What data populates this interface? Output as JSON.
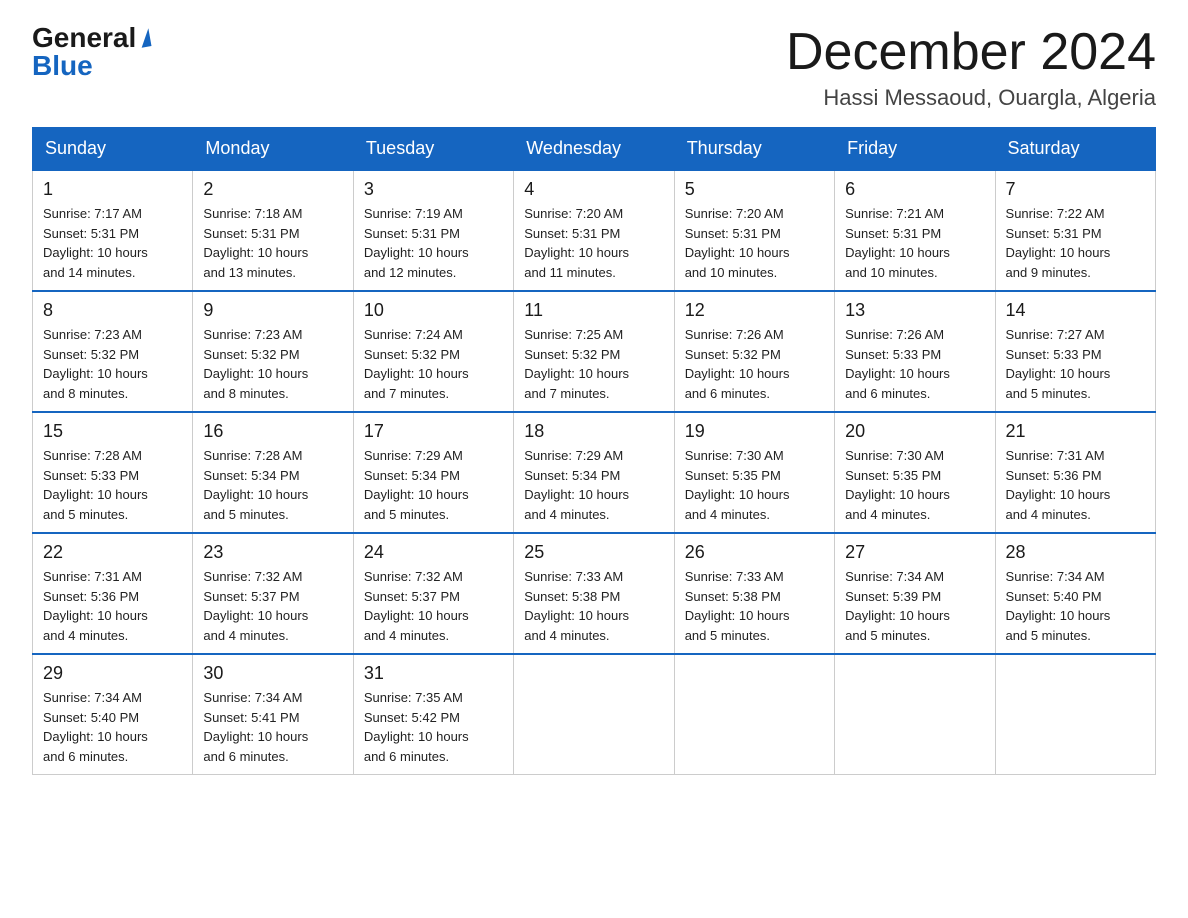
{
  "logo": {
    "general": "General",
    "blue": "Blue"
  },
  "header": {
    "title": "December 2024",
    "location": "Hassi Messaoud, Ouargla, Algeria"
  },
  "weekdays": [
    "Sunday",
    "Monday",
    "Tuesday",
    "Wednesday",
    "Thursday",
    "Friday",
    "Saturday"
  ],
  "weeks": [
    [
      {
        "day": "1",
        "sunrise": "7:17 AM",
        "sunset": "5:31 PM",
        "daylight": "10 hours and 14 minutes."
      },
      {
        "day": "2",
        "sunrise": "7:18 AM",
        "sunset": "5:31 PM",
        "daylight": "10 hours and 13 minutes."
      },
      {
        "day": "3",
        "sunrise": "7:19 AM",
        "sunset": "5:31 PM",
        "daylight": "10 hours and 12 minutes."
      },
      {
        "day": "4",
        "sunrise": "7:20 AM",
        "sunset": "5:31 PM",
        "daylight": "10 hours and 11 minutes."
      },
      {
        "day": "5",
        "sunrise": "7:20 AM",
        "sunset": "5:31 PM",
        "daylight": "10 hours and 10 minutes."
      },
      {
        "day": "6",
        "sunrise": "7:21 AM",
        "sunset": "5:31 PM",
        "daylight": "10 hours and 10 minutes."
      },
      {
        "day": "7",
        "sunrise": "7:22 AM",
        "sunset": "5:31 PM",
        "daylight": "10 hours and 9 minutes."
      }
    ],
    [
      {
        "day": "8",
        "sunrise": "7:23 AM",
        "sunset": "5:32 PM",
        "daylight": "10 hours and 8 minutes."
      },
      {
        "day": "9",
        "sunrise": "7:23 AM",
        "sunset": "5:32 PM",
        "daylight": "10 hours and 8 minutes."
      },
      {
        "day": "10",
        "sunrise": "7:24 AM",
        "sunset": "5:32 PM",
        "daylight": "10 hours and 7 minutes."
      },
      {
        "day": "11",
        "sunrise": "7:25 AM",
        "sunset": "5:32 PM",
        "daylight": "10 hours and 7 minutes."
      },
      {
        "day": "12",
        "sunrise": "7:26 AM",
        "sunset": "5:32 PM",
        "daylight": "10 hours and 6 minutes."
      },
      {
        "day": "13",
        "sunrise": "7:26 AM",
        "sunset": "5:33 PM",
        "daylight": "10 hours and 6 minutes."
      },
      {
        "day": "14",
        "sunrise": "7:27 AM",
        "sunset": "5:33 PM",
        "daylight": "10 hours and 5 minutes."
      }
    ],
    [
      {
        "day": "15",
        "sunrise": "7:28 AM",
        "sunset": "5:33 PM",
        "daylight": "10 hours and 5 minutes."
      },
      {
        "day": "16",
        "sunrise": "7:28 AM",
        "sunset": "5:34 PM",
        "daylight": "10 hours and 5 minutes."
      },
      {
        "day": "17",
        "sunrise": "7:29 AM",
        "sunset": "5:34 PM",
        "daylight": "10 hours and 5 minutes."
      },
      {
        "day": "18",
        "sunrise": "7:29 AM",
        "sunset": "5:34 PM",
        "daylight": "10 hours and 4 minutes."
      },
      {
        "day": "19",
        "sunrise": "7:30 AM",
        "sunset": "5:35 PM",
        "daylight": "10 hours and 4 minutes."
      },
      {
        "day": "20",
        "sunrise": "7:30 AM",
        "sunset": "5:35 PM",
        "daylight": "10 hours and 4 minutes."
      },
      {
        "day": "21",
        "sunrise": "7:31 AM",
        "sunset": "5:36 PM",
        "daylight": "10 hours and 4 minutes."
      }
    ],
    [
      {
        "day": "22",
        "sunrise": "7:31 AM",
        "sunset": "5:36 PM",
        "daylight": "10 hours and 4 minutes."
      },
      {
        "day": "23",
        "sunrise": "7:32 AM",
        "sunset": "5:37 PM",
        "daylight": "10 hours and 4 minutes."
      },
      {
        "day": "24",
        "sunrise": "7:32 AM",
        "sunset": "5:37 PM",
        "daylight": "10 hours and 4 minutes."
      },
      {
        "day": "25",
        "sunrise": "7:33 AM",
        "sunset": "5:38 PM",
        "daylight": "10 hours and 4 minutes."
      },
      {
        "day": "26",
        "sunrise": "7:33 AM",
        "sunset": "5:38 PM",
        "daylight": "10 hours and 5 minutes."
      },
      {
        "day": "27",
        "sunrise": "7:34 AM",
        "sunset": "5:39 PM",
        "daylight": "10 hours and 5 minutes."
      },
      {
        "day": "28",
        "sunrise": "7:34 AM",
        "sunset": "5:40 PM",
        "daylight": "10 hours and 5 minutes."
      }
    ],
    [
      {
        "day": "29",
        "sunrise": "7:34 AM",
        "sunset": "5:40 PM",
        "daylight": "10 hours and 6 minutes."
      },
      {
        "day": "30",
        "sunrise": "7:34 AM",
        "sunset": "5:41 PM",
        "daylight": "10 hours and 6 minutes."
      },
      {
        "day": "31",
        "sunrise": "7:35 AM",
        "sunset": "5:42 PM",
        "daylight": "10 hours and 6 minutes."
      },
      null,
      null,
      null,
      null
    ]
  ],
  "labels": {
    "sunrise": "Sunrise:",
    "sunset": "Sunset:",
    "daylight": "Daylight:"
  }
}
